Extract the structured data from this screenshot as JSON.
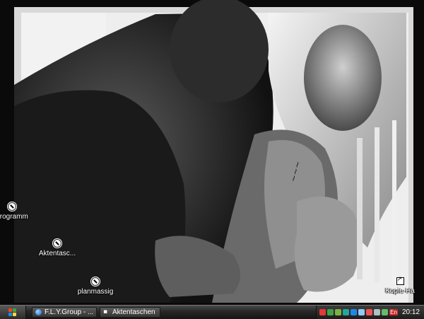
{
  "desktop": {
    "icons": [
      {
        "label": "programm",
        "icon": "program-shortcut-icon"
      },
      {
        "label": "Aktentasc...",
        "icon": "briefcase-shortcut-icon"
      },
      {
        "label": "planmassig",
        "icon": "program-shortcut-icon"
      },
      {
        "label": "Kopie-Ha",
        "icon": "shortcut-icon"
      }
    ]
  },
  "taskbar": {
    "start_icon": "windows-logo-icon",
    "tasks": [
      {
        "label": "F.L.Y.Group - ...",
        "icon": "internet-explorer-icon"
      },
      {
        "label": "Aktentaschen",
        "icon": "briefcase-icon"
      }
    ],
    "tray": {
      "icons": [
        "network-icon",
        "volume-icon",
        "security-icon",
        "messenger-icon",
        "update-icon",
        "display-icon",
        "shield-icon",
        "antivirus-icon",
        "battery-icon"
      ],
      "language": "En",
      "clock": "20:12"
    }
  },
  "colors": {
    "taskbar_top": "#4a4a4a",
    "taskbar_bottom": "#151515",
    "label_text": "#ffffff"
  }
}
